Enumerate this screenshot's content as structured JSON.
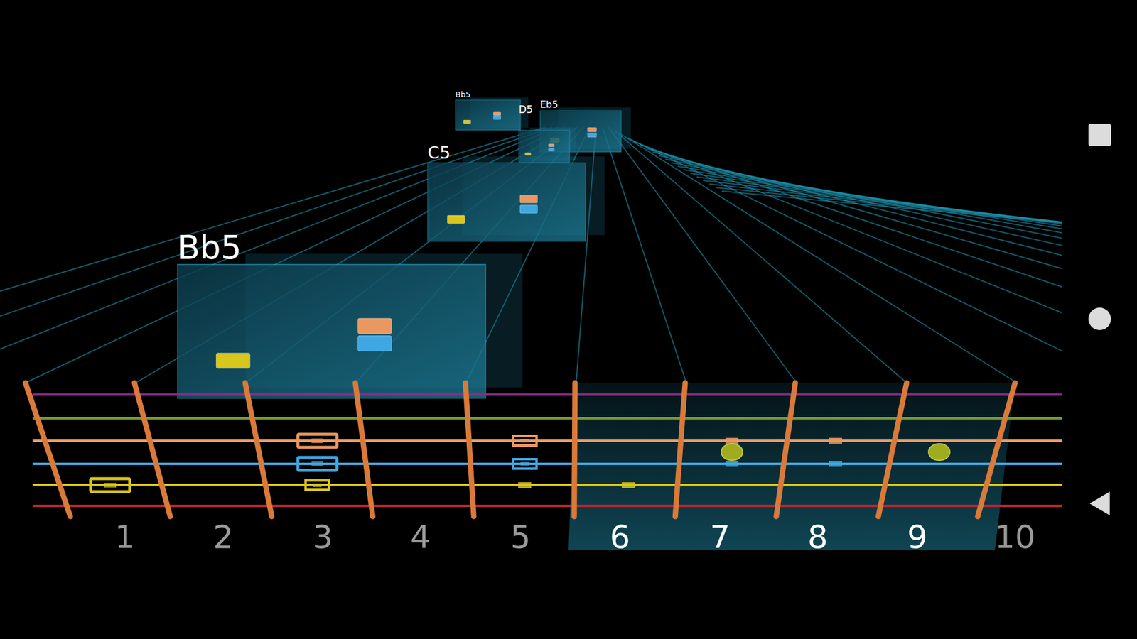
{
  "chords": [
    {
      "name": "Bb5",
      "notes": [
        {
          "string": 1,
          "fret": 1
        },
        {
          "string": 2,
          "fret": 3
        },
        {
          "string": 3,
          "fret": 3
        }
      ]
    },
    {
      "name": "C5",
      "notes": [
        {
          "string": 1,
          "fret": 3
        },
        {
          "string": 2,
          "fret": 5
        },
        {
          "string": 3,
          "fret": 5
        }
      ]
    },
    {
      "name": "D5",
      "notes": [
        {
          "string": 1,
          "fret": 5
        },
        {
          "string": 2,
          "fret": 7
        },
        {
          "string": 3,
          "fret": 7
        }
      ]
    },
    {
      "name": "Eb5",
      "notes": [
        {
          "string": 1,
          "fret": 6
        },
        {
          "string": 2,
          "fret": 8
        },
        {
          "string": 3,
          "fret": 8
        }
      ]
    },
    {
      "name": "Bb5",
      "notes": [
        {
          "string": 1,
          "fret": 1
        },
        {
          "string": 2,
          "fret": 3
        },
        {
          "string": 3,
          "fret": 3
        }
      ]
    }
  ],
  "fretboard": {
    "strings": [
      {
        "color": "#b8252f"
      },
      {
        "color": "#d8c61c"
      },
      {
        "color": "#3fa8e2"
      },
      {
        "color": "#eb9860"
      },
      {
        "color": "#6f9a2a"
      },
      {
        "color": "#8c2c8c"
      }
    ],
    "frets": [
      {
        "label": "1",
        "highlighted": false
      },
      {
        "label": "2",
        "highlighted": false
      },
      {
        "label": "3",
        "highlighted": false
      },
      {
        "label": "4",
        "highlighted": false
      },
      {
        "label": "5",
        "highlighted": false
      },
      {
        "label": "6",
        "highlighted": true
      },
      {
        "label": "7",
        "highlighted": true
      },
      {
        "label": "8",
        "highlighted": true
      },
      {
        "label": "9",
        "highlighted": true
      },
      {
        "label": "10",
        "highlighted": false
      }
    ],
    "markers": [
      {
        "string": 1,
        "fret": 1,
        "kind": "target"
      },
      {
        "string": 2,
        "fret": 3,
        "kind": "target"
      },
      {
        "string": 3,
        "fret": 3,
        "kind": "target"
      },
      {
        "string": 1,
        "fret": 3,
        "kind": "next"
      },
      {
        "string": 2,
        "fret": 5,
        "kind": "next"
      },
      {
        "string": 3,
        "fret": 5,
        "kind": "next"
      },
      {
        "string": 1,
        "fret": 5,
        "kind": "dot"
      },
      {
        "string": 1,
        "fret": 6,
        "kind": "dot"
      },
      {
        "string": 2,
        "fret": 7,
        "kind": "dot"
      },
      {
        "string": 3,
        "fret": 7,
        "kind": "dot"
      },
      {
        "string": 2,
        "fret": 8,
        "kind": "dot"
      },
      {
        "string": 3,
        "fret": 8,
        "kind": "dot"
      },
      {
        "string": 2,
        "fret": 7,
        "kind": "orb"
      },
      {
        "string": 2,
        "fret": 9,
        "kind": "orb"
      }
    ]
  }
}
